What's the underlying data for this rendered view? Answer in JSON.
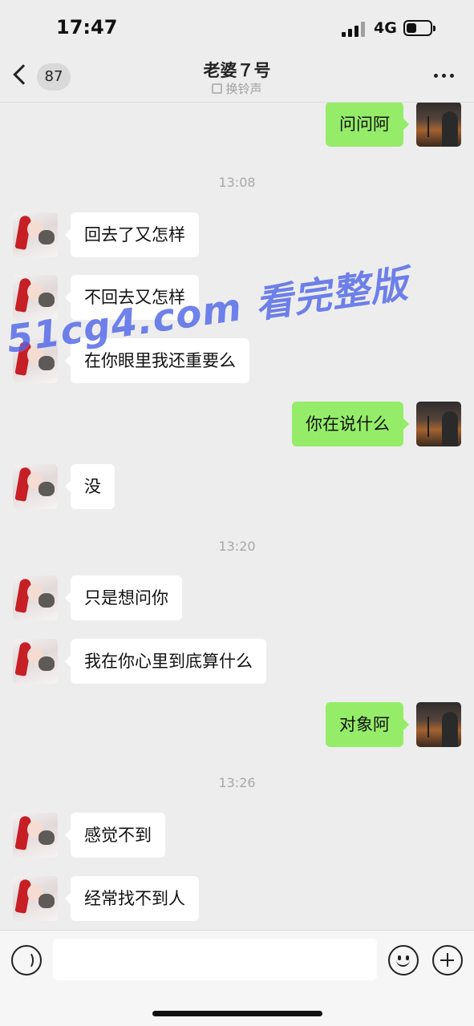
{
  "status_bar": {
    "time": "17:47",
    "network": "4G"
  },
  "header": {
    "unread_count": "87",
    "contact_name": "老婆７号",
    "ringtone_label": "换铃声"
  },
  "messages": [
    {
      "type": "text",
      "from": "me",
      "text": "问问阿"
    },
    {
      "type": "time",
      "text": "13:08"
    },
    {
      "type": "text",
      "from": "her",
      "text": "回去了又怎样"
    },
    {
      "type": "text",
      "from": "her",
      "text": "不回去又怎样"
    },
    {
      "type": "text",
      "from": "her",
      "text": "在你眼里我还重要么"
    },
    {
      "type": "text",
      "from": "me",
      "text": "你在说什么"
    },
    {
      "type": "text",
      "from": "her",
      "text": "没"
    },
    {
      "type": "time",
      "text": "13:20"
    },
    {
      "type": "text",
      "from": "her",
      "text": "只是想问你"
    },
    {
      "type": "text",
      "from": "her",
      "text": "我在你心里到底算什么"
    },
    {
      "type": "text",
      "from": "me",
      "text": "对象阿"
    },
    {
      "type": "time",
      "text": "13:26"
    },
    {
      "type": "text",
      "from": "her",
      "text": "感觉不到"
    },
    {
      "type": "text",
      "from": "her",
      "text": "经常找不到人"
    }
  ],
  "watermark": "51cg4.com 看完整版",
  "input": {
    "value": "",
    "placeholder": ""
  },
  "colors": {
    "outgoing_bubble": "#95ec69",
    "incoming_bubble": "#ffffff",
    "background": "#ededed"
  }
}
